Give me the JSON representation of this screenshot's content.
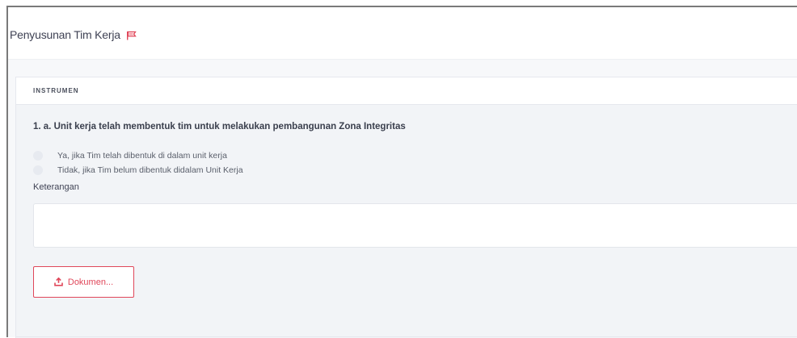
{
  "page": {
    "title": "Penyusunan Tim Kerja"
  },
  "card": {
    "header": "INSTRUMEN",
    "question": "1. a. Unit kerja telah membentuk tim untuk melakukan pembangunan Zona Integritas",
    "options": [
      {
        "label": "Ya, jika Tim telah dibentuk di dalam unit kerja",
        "selected": false
      },
      {
        "label": "Tidak, jika Tim belum dibentuk didalam Unit Kerja",
        "selected": false
      }
    ],
    "keterangan_label": "Keterangan",
    "keterangan_value": "",
    "document_button": "Dokumen..."
  },
  "colors": {
    "accent": "#e0475a",
    "panel_bg": "#f7f8fa",
    "card_bg": "#f2f4f7"
  },
  "icons": {
    "title": "flag-icon",
    "document_button": "upload-icon"
  }
}
